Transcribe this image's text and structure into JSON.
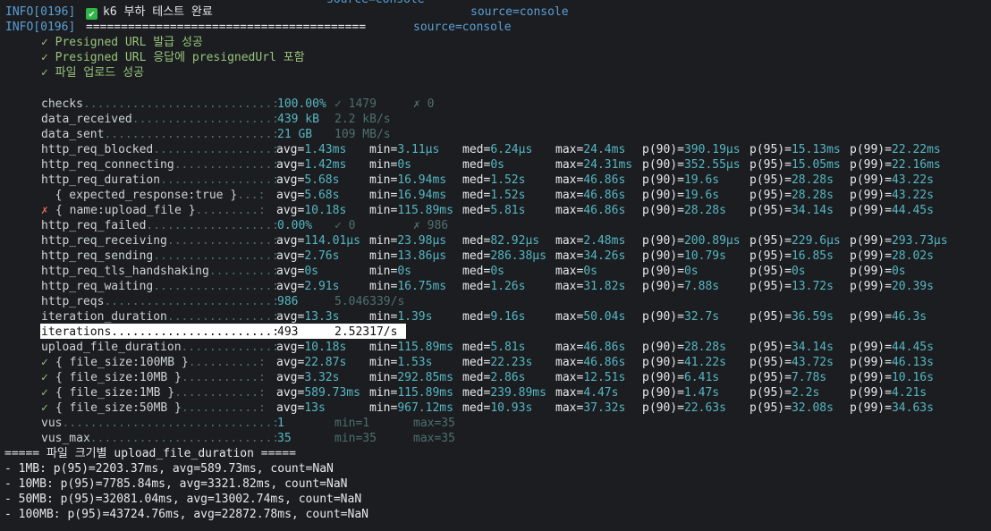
{
  "log": {
    "prefix": "INFO[0196]",
    "top_clipped": "source=console",
    "line1_text": "k6 부하 테스트 완료",
    "line1_source": "source=console",
    "line2_text": "========================================",
    "line2_source": "source=console"
  },
  "checks_list": [
    "✓ Presigned URL 발급 성공",
    "✓ Presigned URL 응답에 presignedUrl 포함",
    "✓ 파일 업로드 성공"
  ],
  "metrics": [
    {
      "mark": "",
      "name": "checks",
      "dots": "...........................",
      "val": "100.00%",
      "sub": "✓ 1479",
      "extra": "✗ 0"
    },
    {
      "mark": "",
      "name": "data_received",
      "dots": "....................",
      "val": "439 kB",
      "sub": "2.2 kB/s"
    },
    {
      "mark": "",
      "name": "data_sent",
      "dots": "........................",
      "val": "21 GB",
      "sub": "109 MB/s"
    },
    {
      "mark": "",
      "name": "http_req_blocked",
      "dots": ".................",
      "stats": [
        "avg=1.43ms",
        "min=3.11µs",
        "med=6.24µs",
        "max=24.4ms",
        "p(90)=390.19µs",
        "p(95)=15.13ms",
        "p(99)=22.22ms"
      ]
    },
    {
      "mark": "",
      "name": "http_req_connecting",
      "dots": "..............",
      "stats": [
        "avg=1.42ms",
        "min=0s",
        "med=0s",
        "max=24.31ms",
        "p(90)=352.55µs",
        "p(95)=15.05ms",
        "p(99)=22.16ms"
      ]
    },
    {
      "mark": "",
      "name": "http_req_duration",
      "dots": "................",
      "stats": [
        "avg=5.68s",
        "min=16.94ms",
        "med=1.52s",
        "max=46.86s",
        "p(90)=19.6s",
        "p(95)=28.28s",
        "p(99)=43.22s"
      ]
    },
    {
      "mark": "",
      "name": "  { expected_response:true }",
      "dots": "...",
      "stats": [
        "avg=5.68s",
        "min=16.94ms",
        "med=1.52s",
        "max=46.86s",
        "p(90)=19.6s",
        "p(95)=28.28s",
        "p(99)=43.22s"
      ]
    },
    {
      "mark": "✗",
      "name": "{ name:upload_file }",
      "dots": ".........",
      "stats": [
        "avg=10.18s",
        "min=115.89ms",
        "med=5.81s",
        "max=46.86s",
        "p(90)=28.28s",
        "p(95)=34.14s",
        "p(99)=44.45s"
      ]
    },
    {
      "mark": "",
      "name": "http_req_failed",
      "dots": "..................",
      "val": "0.00%",
      "sub": "✓ 0",
      "extra": "✗ 986"
    },
    {
      "mark": "",
      "name": "http_req_receiving",
      "dots": "...............",
      "stats": [
        "avg=114.01µs",
        "min=23.98µs",
        "med=82.92µs",
        "max=2.48ms",
        "p(90)=200.89µs",
        "p(95)=229.6µs",
        "p(99)=293.73µs"
      ]
    },
    {
      "mark": "",
      "name": "http_req_sending",
      "dots": ".................",
      "stats": [
        "avg=2.76s",
        "min=13.86µs",
        "med=286.38µs",
        "max=34.26s",
        "p(90)=10.79s",
        "p(95)=16.85s",
        "p(99)=28.02s"
      ]
    },
    {
      "mark": "",
      "name": "http_req_tls_handshaking",
      "dots": ".........",
      "stats": [
        "avg=0s",
        "min=0s",
        "med=0s",
        "max=0s",
        "p(90)=0s",
        "p(95)=0s",
        "p(99)=0s"
      ]
    },
    {
      "mark": "",
      "name": "http_req_waiting",
      "dots": ".................",
      "stats": [
        "avg=2.91s",
        "min=16.75ms",
        "med=1.26s",
        "max=31.82s",
        "p(90)=7.88s",
        "p(95)=13.72s",
        "p(99)=20.39s"
      ]
    },
    {
      "mark": "",
      "name": "http_reqs",
      "dots": "........................",
      "val": "986",
      "sub": "5.046339/s"
    },
    {
      "mark": "",
      "name": "iteration_duration",
      "dots": "...............",
      "stats": [
        "avg=13.3s",
        "min=1.39s",
        "med=9.16s",
        "max=50.04s",
        "p(90)=32.7s",
        "p(95)=36.59s",
        "p(99)=46.3s"
      ]
    },
    {
      "mark": "",
      "name": "iterations",
      "dots": ".......................",
      "val": "493",
      "sub": "2.52317/s",
      "highlight": true
    },
    {
      "mark": "",
      "name": "upload_file_duration",
      "dots": ".............",
      "stats": [
        "avg=10.18s",
        "min=115.89ms",
        "med=5.81s",
        "max=46.86s",
        "p(90)=28.28s",
        "p(95)=34.14s",
        "p(99)=44.45s"
      ]
    },
    {
      "mark": "✓",
      "name": "{ file_size:100MB }",
      "dots": "..........",
      "stats": [
        "avg=22.87s",
        "min=1.53s",
        "med=22.23s",
        "max=46.86s",
        "p(90)=41.22s",
        "p(95)=43.72s",
        "p(99)=46.13s"
      ]
    },
    {
      "mark": "✓",
      "name": "{ file_size:10MB }",
      "dots": "...........",
      "stats": [
        "avg=3.32s",
        "min=292.85ms",
        "med=2.86s",
        "max=12.51s",
        "p(90)=6.41s",
        "p(95)=7.78s",
        "p(99)=10.16s"
      ]
    },
    {
      "mark": "✓",
      "name": "{ file_size:1MB }",
      "dots": "............",
      "stats": [
        "avg=589.73ms",
        "min=115.89ms",
        "med=239.89ms",
        "max=4.47s",
        "p(90)=1.47s",
        "p(95)=2.2s",
        "p(99)=4.21s"
      ]
    },
    {
      "mark": "✓",
      "name": "{ file_size:50MB }",
      "dots": "...........",
      "stats": [
        "avg=13s",
        "min=967.12ms",
        "med=10.93s",
        "max=37.32s",
        "p(90)=22.63s",
        "p(95)=32.08s",
        "p(99)=34.63s"
      ]
    },
    {
      "mark": "",
      "name": "vus",
      "dots": "..............................",
      "val": "1",
      "sub": "min=1",
      "extra": "max=35"
    },
    {
      "mark": "",
      "name": "vus_max",
      "dots": "..........................",
      "val": "35",
      "sub": "min=35",
      "extra": "max=35"
    }
  ],
  "summary": {
    "header": "===== 파일 크기별 upload_file_duration =====",
    "lines": [
      "- 1MB: p(95)=2203.37ms, avg=589.73ms, count=NaN",
      "- 10MB: p(95)=7785.84ms, avg=3321.82ms, count=NaN",
      "- 50MB: p(95)=32081.04ms, avg=13002.74ms, count=NaN",
      "- 100MB: p(95)=43724.76ms, avg=22872.78ms, count=NaN"
    ]
  },
  "colors": {
    "background": "#1b1d20",
    "info_prefix": "#5b9fd6",
    "metric_value": "#56b6c2",
    "dim": "#4f6f70",
    "check_ok": "#97c37a",
    "check_fail": "#e06c5c"
  },
  "icons": {
    "complete": "check-mark-button-icon",
    "pass": "check-icon",
    "fail": "cross-icon"
  }
}
